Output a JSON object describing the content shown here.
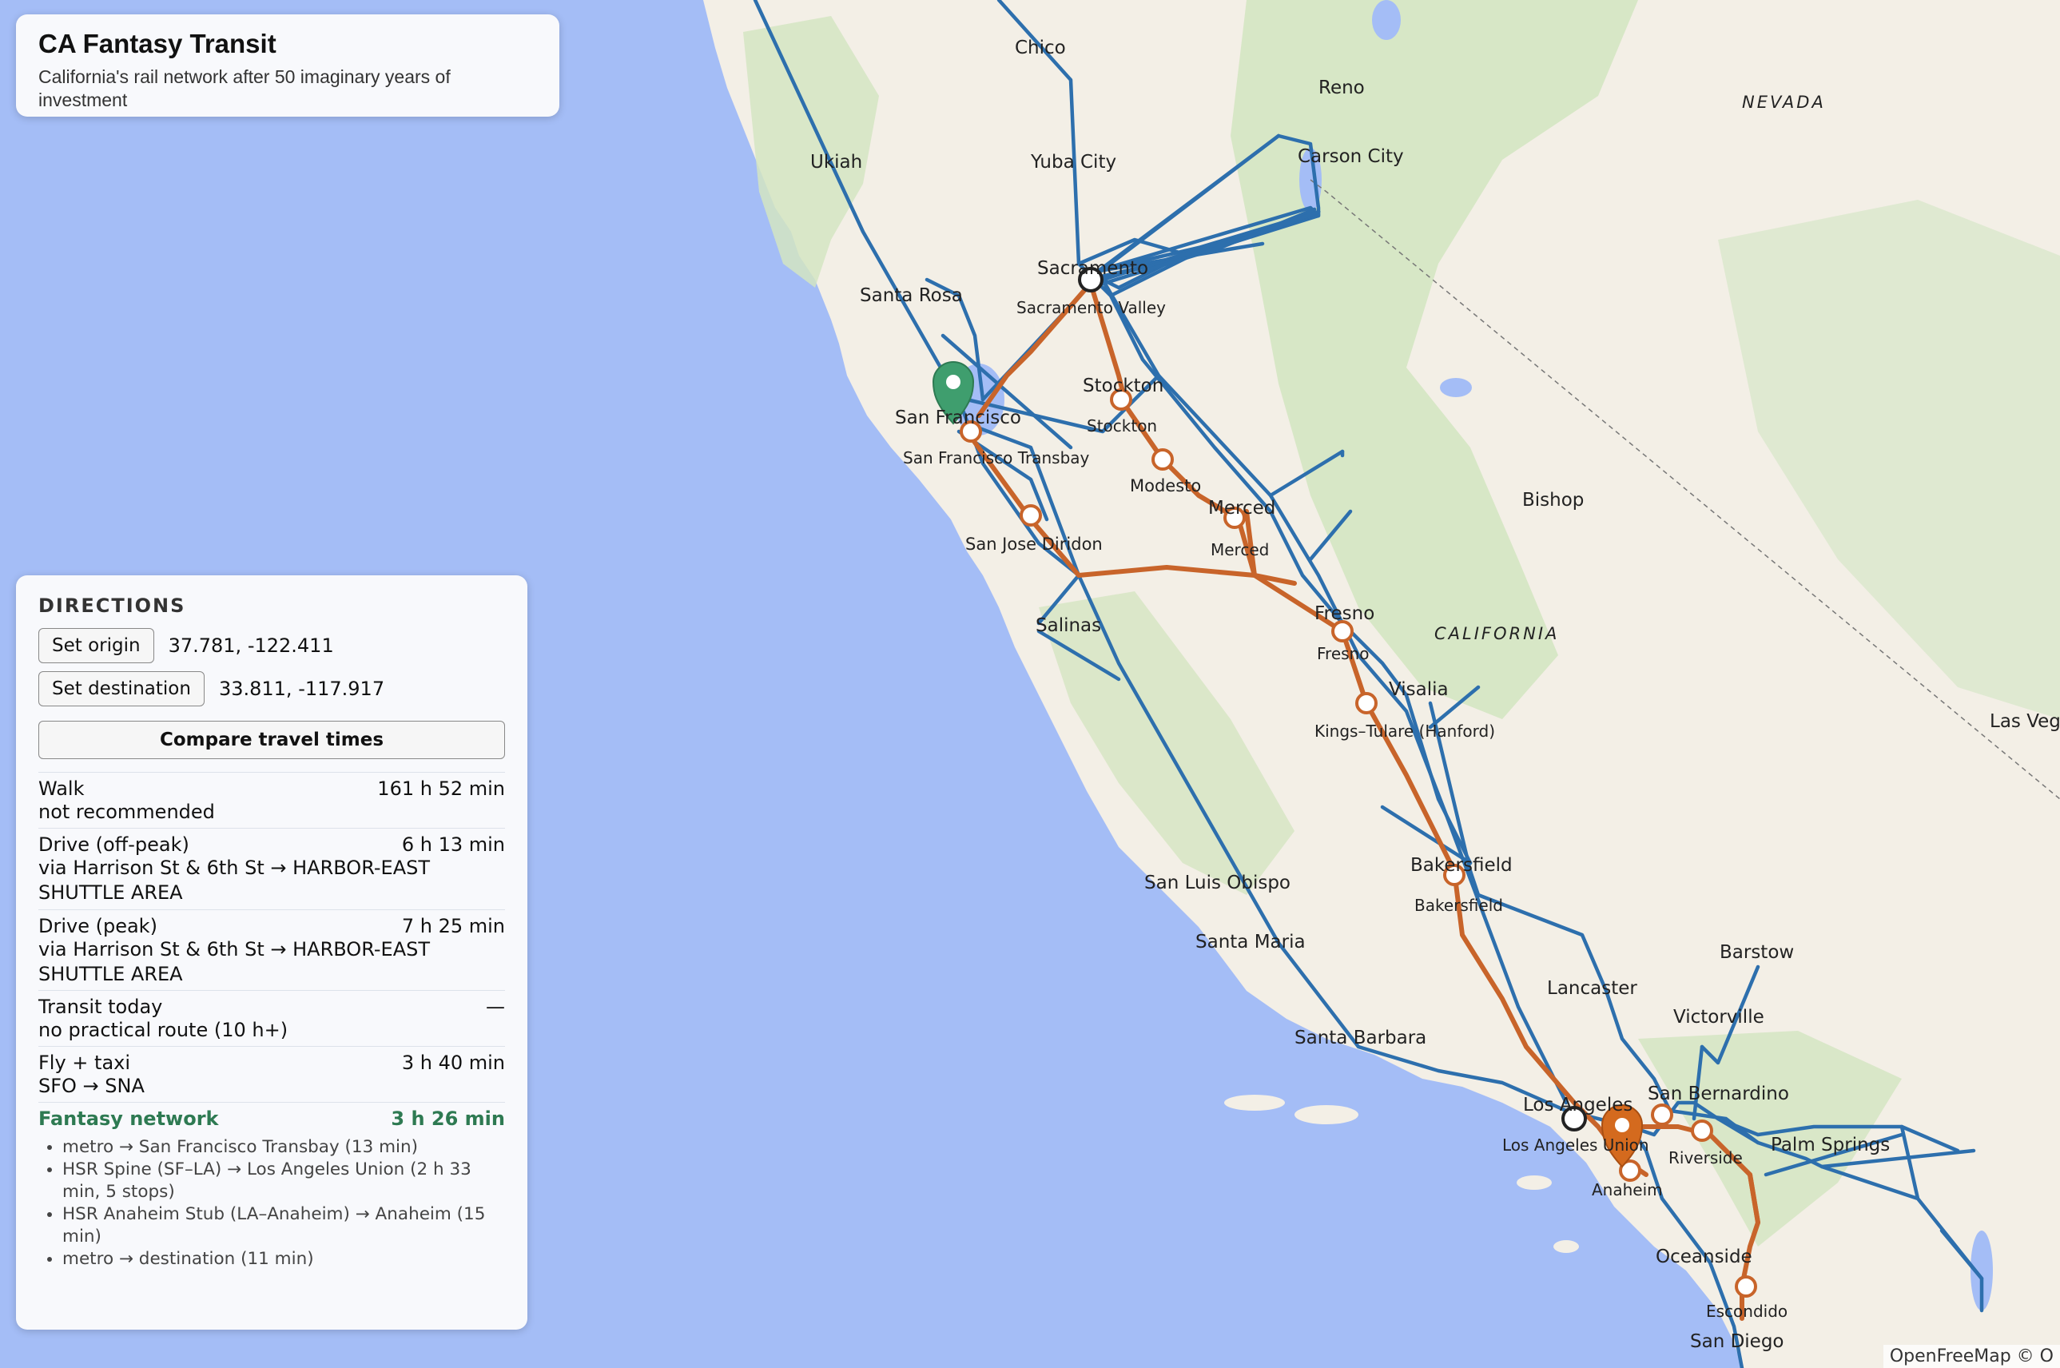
{
  "app": {
    "title": "CA Fantasy Transit",
    "subtitle": "California's rail network after 50 imaginary years of investment"
  },
  "directions": {
    "heading": "DIRECTIONS",
    "set_origin_label": "Set origin",
    "origin_value": "37.781, -122.411",
    "set_destination_label": "Set destination",
    "destination_value": "33.811, -117.917",
    "compare_label": "Compare travel times",
    "results": [
      {
        "mode": "Walk",
        "time": "161 h 52 min",
        "detail": "not recommended"
      },
      {
        "mode": "Drive (off-peak)",
        "time": "6 h 13 min",
        "detail": "via Harrison St & 6th St → HARBOR-EAST SHUTTLE AREA"
      },
      {
        "mode": "Drive (peak)",
        "time": "7 h 25 min",
        "detail": "via Harrison St & 6th St → HARBOR-EAST SHUTTLE AREA"
      },
      {
        "mode": "Transit today",
        "time": "—",
        "detail": "no practical route (10 h+)"
      },
      {
        "mode": "Fly + taxi",
        "time": "3 h 40 min",
        "detail": "SFO → SNA"
      }
    ],
    "fantasy": {
      "mode": "Fantasy network",
      "time": "3 h 26 min",
      "steps": [
        "metro → San Francisco Transbay (13 min)",
        "HSR Spine (SF–LA) → Los Angeles Union (2 h 33 min, 5 stops)",
        "HSR Anaheim Stub (LA–Anaheim) → Anaheim (15 min)",
        "metro → destination (11 min)"
      ]
    }
  },
  "map": {
    "attribution": "OpenFreeMap © O",
    "colors": {
      "water": "#a4bdf6",
      "land": "#f3efe6",
      "green": "#d4e5c2",
      "hsr": "#c8642a",
      "rail": "#2d6fad",
      "origin": "#3f9e6e",
      "destination": "#d46a1e"
    },
    "region_labels": {
      "nevada": "NEVADA",
      "california": "CALIFORNIA"
    },
    "cities": {
      "chico": "Chico",
      "reno": "Reno",
      "carson": "Carson City",
      "ukiah": "Ukiah",
      "yuba": "Yuba City",
      "santa_rosa": "Santa Rosa",
      "sacramento": "Sacramento",
      "sac_valley": "Sacramento Valley",
      "stockton": "Stockton",
      "stockton_st": "Stockton",
      "sf": "San Francisco",
      "sf_transbay": "San Francisco Transbay",
      "modesto": "Modesto",
      "merced": "Merced",
      "merced_st": "Merced",
      "bishop": "Bishop",
      "sanjose": "San Jose Diridon",
      "fresno": "Fresno",
      "fresno_st": "Fresno",
      "salinas": "Salinas",
      "visalia": "Visalia",
      "kings": "Kings–Tulare (Hanford)",
      "lasvegas": "Las Vegas",
      "slo": "San Luis Obispo",
      "bakersfield": "Bakersfield",
      "bakersfield_st": "Bakersfield",
      "santa_maria": "Santa Maria",
      "barstow": "Barstow",
      "lancaster": "Lancaster",
      "victorville": "Victorville",
      "santa_barbara": "Santa Barbara",
      "losangeles": "Los Angeles",
      "la_union": "Los Angeles Union",
      "sanbern": "San Bernardino",
      "riverside": "Riverside",
      "palm": "Palm Springs",
      "anaheim": "Anaheim",
      "oceanside": "Oceanside",
      "escondido": "Escondido",
      "sandiego": "San Diego"
    }
  }
}
